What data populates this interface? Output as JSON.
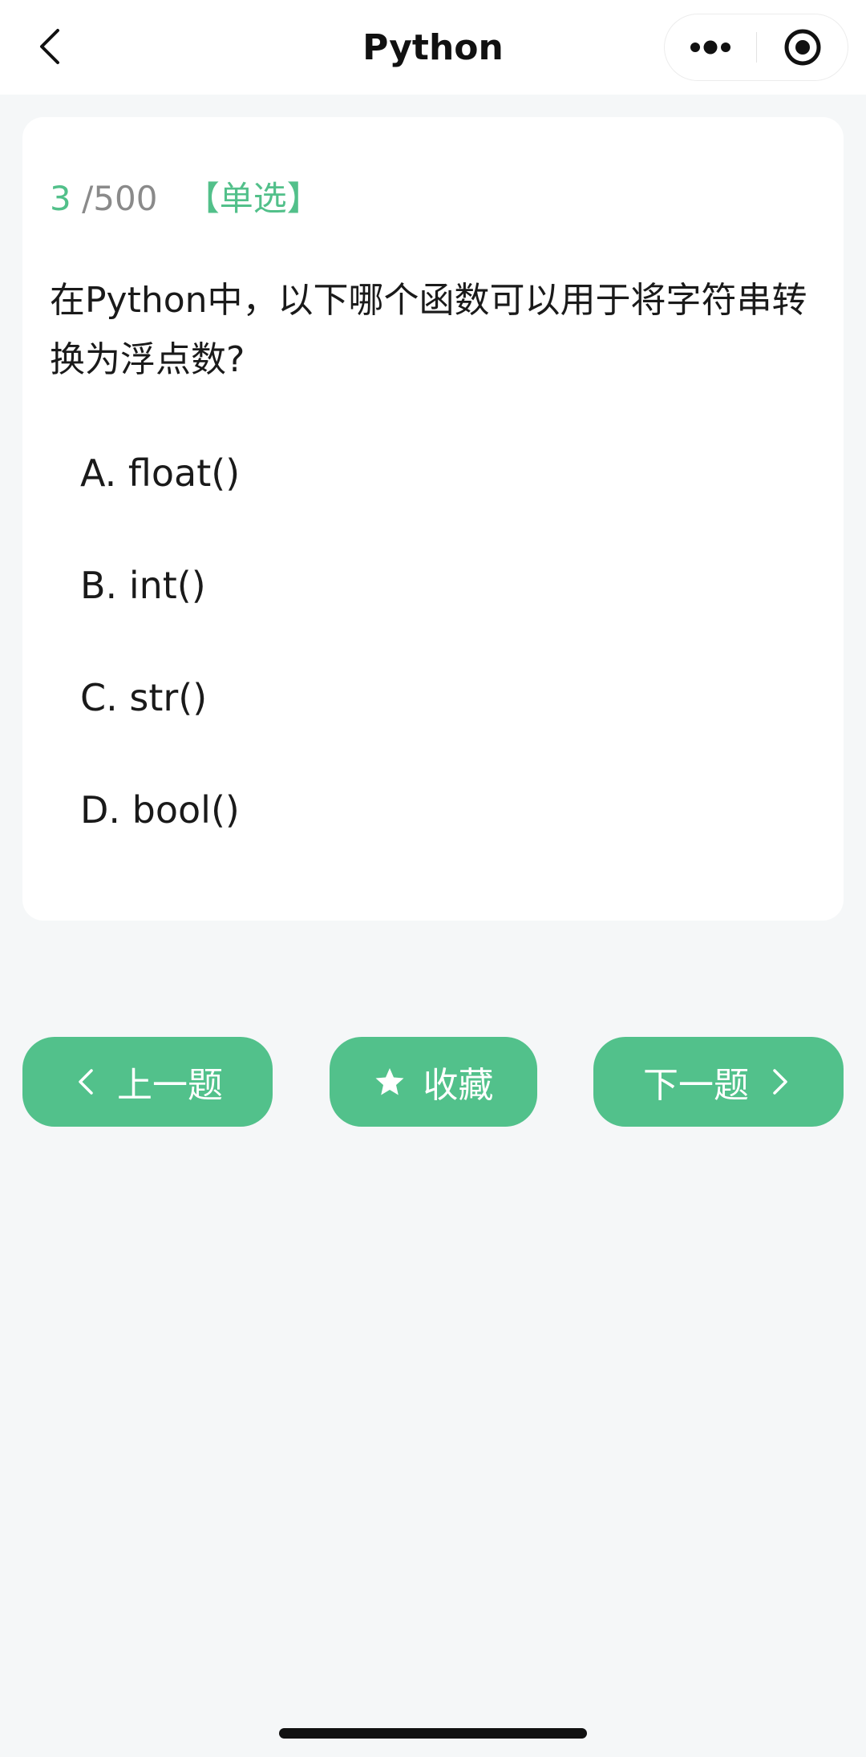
{
  "nav": {
    "title": "Python",
    "icons": {
      "back": "chevron-left-icon",
      "more": "more-dots-icon",
      "close": "target-circle-icon"
    }
  },
  "question": {
    "current": "3",
    "total": "/500",
    "type": "【单选】",
    "text": "在Python中，以下哪个函数可以用于将字符串转换为浮点数?",
    "options": [
      {
        "letter": "A.",
        "text": "float()"
      },
      {
        "letter": "B.",
        "text": "int()"
      },
      {
        "letter": "C.",
        "text": "str()"
      },
      {
        "letter": "D.",
        "text": "bool()"
      }
    ]
  },
  "actions": {
    "prev_label": "上一题",
    "favorite_label": "收藏",
    "next_label": "下一题"
  },
  "colors": {
    "accent": "#52c18b",
    "background": "#f5f7f8",
    "card": "#ffffff"
  }
}
